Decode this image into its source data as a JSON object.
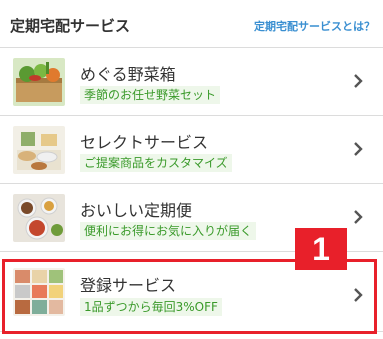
{
  "header": {
    "title": "定期宅配サービス",
    "link_label": "定期宅配サービスとは？"
  },
  "items": [
    {
      "title": "めぐる野菜箱",
      "subtitle": "季節のお任せ野菜セット",
      "icon": "vegetable-box-photo"
    },
    {
      "title": "セレクトサービス",
      "subtitle": "ご提案商品をカスタマイズ",
      "icon": "select-service-photo"
    },
    {
      "title": "おいしい定期便",
      "subtitle": "便利にお得にお気に入りが届く",
      "icon": "regular-delivery-photo"
    },
    {
      "title": "登録サービス",
      "subtitle": "1品ずつから毎回3%OFF",
      "icon": "registration-service-photo"
    }
  ],
  "annotation": {
    "badge_label": "1",
    "color": "#e8202a"
  },
  "colors": {
    "accent_link": "#3a8fd1",
    "subtitle_text": "#3a9a2a",
    "subtitle_bg": "#eef7ea"
  }
}
